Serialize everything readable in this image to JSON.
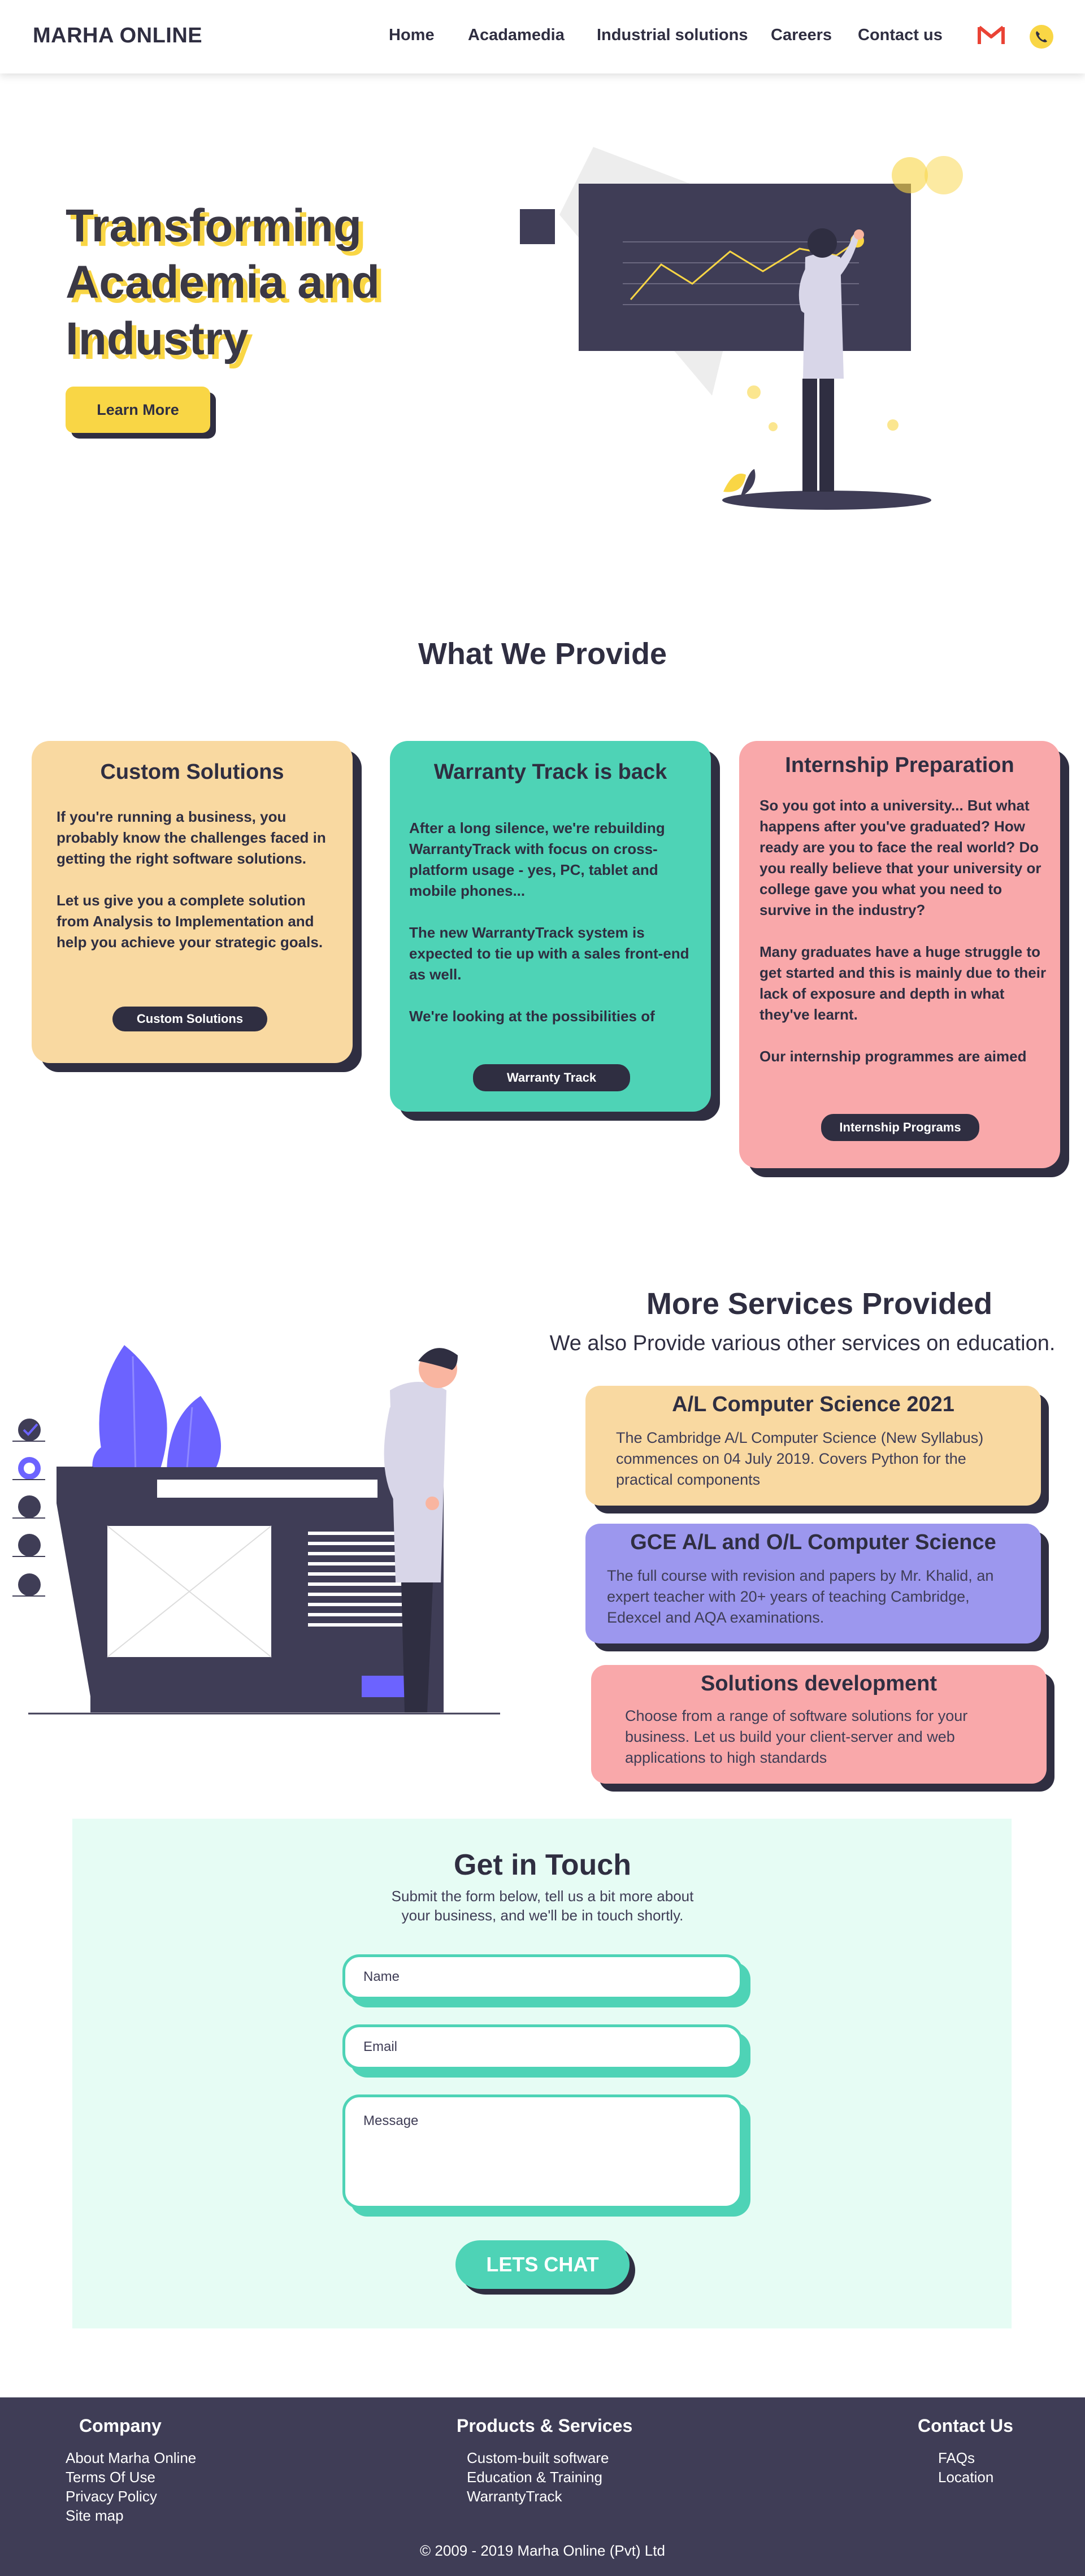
{
  "nav": {
    "brand": "MARHA ONLINE",
    "links": [
      "Home",
      "Acadamedia",
      "Industrial solutions",
      "Careers",
      "Contact us"
    ],
    "icons": [
      "gmail-icon",
      "phone-icon"
    ]
  },
  "hero": {
    "title": "Transforming Academia and Industry",
    "button": "Learn More"
  },
  "provide": {
    "title": "What We Provide",
    "cards": [
      {
        "title": "Custom Solutions",
        "paragraphs": [
          "If you're running a business, you probably know the challenges faced in getting the right software solutions.",
          "Let us give you a complete solution from Analysis to Implementation and help you achieve your strategic goals."
        ],
        "button": "Custom Solutions",
        "color": "#f9d9a1"
      },
      {
        "title": "Warranty Track is back",
        "paragraphs": [
          "After a long silence, we're rebuilding WarrantyTrack with focus on cross-platform usage - yes, PC, tablet and mobile phones...",
          "The new WarrantyTrack system is expected to tie up with a sales front-end as well.",
          "We're looking at the possibilities of"
        ],
        "button": "Warranty Track",
        "color": "#4ed3b6"
      },
      {
        "title": "Internship Preparation",
        "paragraphs": [
          "So you got into a university... But what happens after you've graduated? How ready are you to face the real world? Do you really believe that your university or college gave you what you need to survive in the industry?",
          "Many graduates have a huge struggle to get started and this is mainly due to their lack of exposure and depth in what they've learnt.",
          "Our internship programmes are aimed"
        ],
        "button": "Internship Programs",
        "color": "#f9a8aa"
      }
    ]
  },
  "services": {
    "title": "More Services Provided",
    "subtitle": "We also Provide various other services on education.",
    "items": [
      {
        "title": "A/L Computer Science 2021",
        "body": "The Cambridge A/L Computer Science (New Syllabus) commences on 04 July 2019. Covers Python for the practical components",
        "color": "#f9d9a1"
      },
      {
        "title": "GCE A/L and O/L Computer Science",
        "body": "The full course with revision and papers by Mr. Khalid, an expert teacher with 20+ years of teaching Cambridge, Edexcel and AQA examinations.",
        "color": "#9c97ee"
      },
      {
        "title": "Solutions development",
        "body": "Choose from a range of software solutions for your business. Let us build your client-server and web applications to high standards",
        "color": "#f9a8aa"
      }
    ]
  },
  "contact": {
    "title": "Get in Touch",
    "subtitle_line1": "Submit the form below, tell us a bit more about",
    "subtitle_line2": "your business, and we'll be in touch shortly.",
    "name_placeholder": "Name",
    "email_placeholder": "Email",
    "message_placeholder": "Message",
    "button": "LETS CHAT"
  },
  "footer": {
    "company_title": "Company",
    "company_links": [
      "About Marha Online",
      "Terms Of Use",
      "Privacy Policy",
      "Site map"
    ],
    "products_title": "Products & Services",
    "products_links": [
      "Custom-built software",
      "Education & Training",
      "WarrantyTrack"
    ],
    "contact_title": "Contact Us",
    "contact_links": [
      "FAQs",
      "Location"
    ],
    "copyright": "© 2009 - 2019 Marha Online (Pvt) Ltd"
  },
  "colors": {
    "dark": "#2f2e41",
    "yellow": "#f9d645",
    "teal": "#4ed3b6",
    "purple": "#6c63ff",
    "footer_bg": "#3f3d56"
  }
}
